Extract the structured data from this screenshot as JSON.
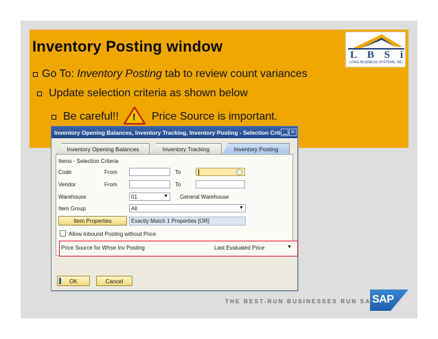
{
  "slide": {
    "title": "Inventory Posting window",
    "bullets": {
      "b1_prefix": "Go To: ",
      "b1_italic": "Inventory Posting",
      "b1_suffix": " tab to review count variances",
      "b2": "Update selection criteria as shown below",
      "b3_before": "Be careful!!",
      "b3_after": "Price Source is important."
    },
    "warning_icon_glyph": "!",
    "logo": {
      "letters": [
        "L",
        "B",
        "S",
        "i"
      ],
      "subtitle": "LONG BUSINESS SYSTEMS, INC"
    },
    "tagline": "THE BEST-RUN BUSINESSES RUN SAP",
    "sap_logo_text": "SAP"
  },
  "window": {
    "title": "Inventory Opening Balances, Inventory Tracking, Inventory Posting - Selection Criteria",
    "close_glyph": "×",
    "tabs": [
      {
        "label": "Inventory Opening Balances"
      },
      {
        "label": "Inventory Tracking"
      },
      {
        "label": "Inventory Posting"
      }
    ],
    "section_title": "Items - Selection Criteria",
    "code": {
      "label": "Code",
      "from_label": "From",
      "to_label": "To"
    },
    "vendor": {
      "label": "Vendor",
      "from_label": "From",
      "to_label": "To"
    },
    "warehouse": {
      "label": "Warehouse",
      "value": "01",
      "name": "General Warehouse"
    },
    "item_group": {
      "label": "Item Group",
      "value": "All"
    },
    "item_properties": {
      "button_label": "Item Properties",
      "value": "Exactly Match 1 Properties [OR]"
    },
    "allow_inbound": {
      "label": "Allow Inbound Posting without Price",
      "checked": false
    },
    "price_source": {
      "label": "Price Source for Whse Inv Posting",
      "value": "Last Evaluated Price"
    },
    "dropdown_glyph": "▼",
    "buttons": {
      "ok": "OK",
      "cancel": "Cancel"
    }
  },
  "colors": {
    "orange_band": "#f0a800",
    "highlight_border": "#e0102a",
    "sap_blue": "#1d5fae"
  }
}
